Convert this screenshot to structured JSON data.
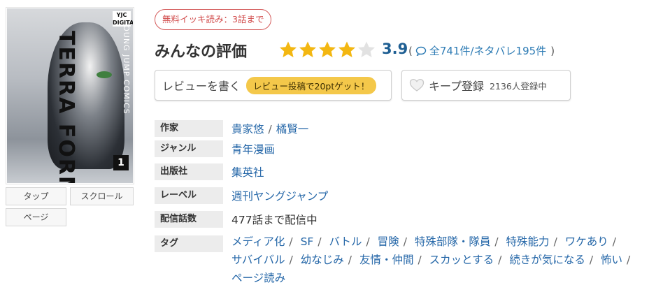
{
  "cover": {
    "vertical_title": "TERRA FORMARS",
    "vertical_label": "YOUNG JUMP COMICS",
    "publisher_badge": "YJC DIGITAL",
    "volume": "1"
  },
  "view_modes": {
    "tap": "タップ",
    "scroll": "スクロール",
    "page": "ページ"
  },
  "free_badge": "無料イッキ読み：3話まで",
  "review": {
    "title": "みんなの評価",
    "stars_filled": 4,
    "stars_total": 5,
    "rating": "3.9",
    "open_paren": "(",
    "count_text": "全741件/ネタバレ195件",
    "close_paren": ")",
    "star_color": "#f3b712",
    "star_empty_color": "#e2e2e2"
  },
  "buttons": {
    "write_review": "レビューを書く",
    "review_promo": "レビュー投稿で20ptゲット！",
    "keep": "キープ登録",
    "keep_count": "2136人登録中"
  },
  "info": {
    "author_label": "作家",
    "authors": [
      "貴家悠",
      "橘賢一"
    ],
    "author_sep": "/",
    "genre_label": "ジャンル",
    "genre": "青年漫画",
    "publisher_label": "出版社",
    "publisher": "集英社",
    "label_label": "レーベル",
    "label": "週刊ヤングジャンプ",
    "episodes_label": "配信話数",
    "episodes": "477話まで配信中",
    "tags_label": "タグ",
    "tags": [
      "メディア化",
      "SF",
      "バトル",
      "冒険",
      "特殊部隊・隊員",
      "特殊能力",
      "ワケあり",
      "サバイバル",
      "幼なじみ",
      "友情・仲間",
      "スカッとする",
      "続きが気になる",
      "怖い",
      "ページ読み"
    ],
    "tag_sep": "/"
  }
}
